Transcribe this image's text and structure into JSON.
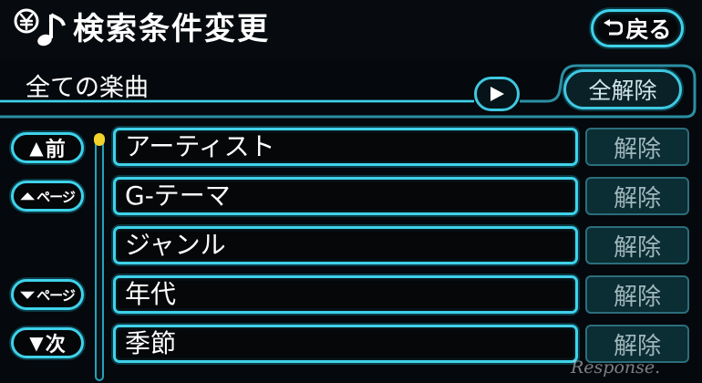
{
  "header": {
    "title": "検索条件変更",
    "back_label": "戻る"
  },
  "scope": {
    "label": "全ての楽曲",
    "clear_all_label": "全解除"
  },
  "nav": {
    "prev_label": "前",
    "page_up_label": "ページ",
    "page_down_label": "ページ",
    "next_label": "次"
  },
  "items": [
    {
      "label": "アーティスト",
      "clear_label": "解除"
    },
    {
      "label": "G-テーマ",
      "clear_label": "解除"
    },
    {
      "label": "ジャンル",
      "clear_label": "解除"
    },
    {
      "label": "年代",
      "clear_label": "解除"
    },
    {
      "label": "季節",
      "clear_label": "解除"
    }
  ],
  "watermark": "Response.",
  "colors": {
    "accent": "#3fd2ea",
    "background": "#05080c",
    "scroll_thumb": "#f2d22a",
    "button_fill": "#0b2d34"
  },
  "icons": {
    "app": "music-note-yen-icon",
    "back": "return-arrow-icon",
    "play": "play-icon"
  }
}
